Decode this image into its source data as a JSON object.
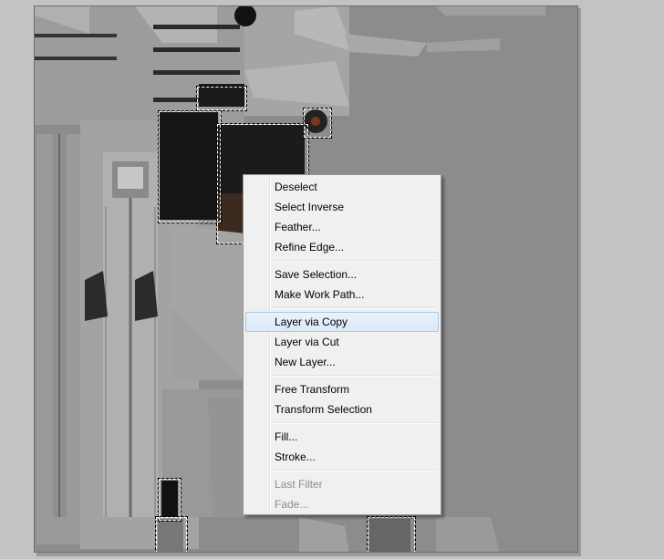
{
  "context_menu": {
    "groups": [
      [
        "Deselect",
        "Select Inverse",
        "Feather...",
        "Refine Edge..."
      ],
      [
        "Save Selection...",
        "Make Work Path..."
      ],
      [
        "Layer via Copy",
        "Layer via Cut",
        "New Layer..."
      ],
      [
        "Free Transform",
        "Transform Selection"
      ],
      [
        "Fill...",
        "Stroke..."
      ],
      [
        "Last Filter",
        "Fade..."
      ]
    ],
    "highlighted": "Layer via Copy",
    "disabled": [
      "Last Filter",
      "Fade..."
    ]
  },
  "colors": {
    "app_background": "#c3c3c3",
    "canvas_background": "#8c8c8c",
    "menu_background": "#f0f0f0",
    "highlight": "#dbe9f8"
  }
}
